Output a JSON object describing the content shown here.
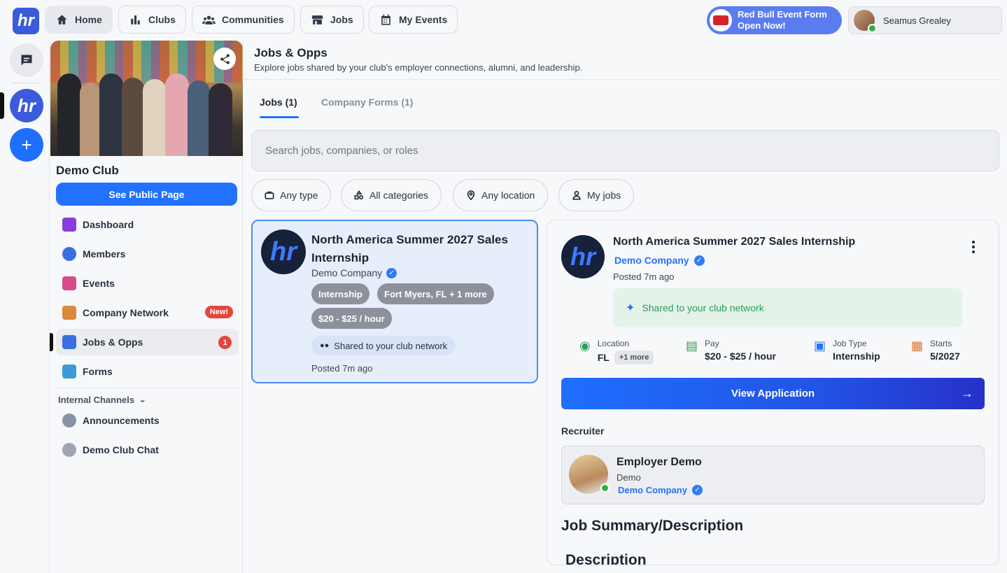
{
  "topnav": {
    "logo_text": "hr",
    "items": [
      {
        "label": "Home",
        "icon": "home-icon",
        "active": true
      },
      {
        "label": "Clubs",
        "icon": "bar-chart-icon",
        "active": false
      },
      {
        "label": "Communities",
        "icon": "people-icon",
        "active": false
      },
      {
        "label": "Jobs",
        "icon": "store-icon",
        "active": false
      },
      {
        "label": "My Events",
        "icon": "calendar-icon",
        "active": false
      }
    ],
    "promo": {
      "line1": "Red Bull Event Form",
      "line2": "Open Now!"
    },
    "user": {
      "name": "Seamus Grealey",
      "status": "online"
    }
  },
  "rail": {
    "club_logo_text": "hr",
    "add_symbol": "+"
  },
  "club": {
    "name": "Demo Club",
    "public_button": "See Public Page",
    "menu": [
      {
        "label": "Dashboard",
        "icon": "dashboard-icon",
        "color": "#8b3bd9"
      },
      {
        "label": "Members",
        "icon": "members-icon",
        "color": "#3b6fe0"
      },
      {
        "label": "Events",
        "icon": "events-calendar-icon",
        "color": "#d94a8c"
      },
      {
        "label": "Company Network",
        "icon": "network-icon",
        "color": "#d98a3b",
        "badge": "New!"
      },
      {
        "label": "Jobs & Opps",
        "icon": "jobs-icon",
        "color": "#3b6fe0",
        "count": "1",
        "active": true
      },
      {
        "label": "Forms",
        "icon": "forms-icon",
        "color": "#3b9bd9"
      }
    ],
    "channels_heading": "Internal Channels",
    "channels": [
      {
        "label": "Announcements",
        "icon": "megaphone-icon"
      },
      {
        "label": "Demo Club Chat",
        "icon": "chat-bubble-icon"
      }
    ]
  },
  "main": {
    "title": "Jobs & Opps",
    "subtitle": "Explore jobs shared by your club's employer connections, alumni, and leadership.",
    "tabs": [
      {
        "label": "Jobs (1)",
        "active": true
      },
      {
        "label": "Company Forms (1)",
        "active": false
      }
    ],
    "search_placeholder": "Search jobs, companies, or roles",
    "filters": [
      {
        "label": "Any type",
        "icon": "briefcase-icon"
      },
      {
        "label": "All categories",
        "icon": "shapes-icon"
      },
      {
        "label": "Any location",
        "icon": "location-pin-icon"
      },
      {
        "label": "My jobs",
        "icon": "user-icon"
      }
    ]
  },
  "job_card": {
    "logo_text": "hr",
    "title": "North America Summer 2027 Sales Internship",
    "company": "Demo Company",
    "chips": [
      "Internship",
      "Fort Myers, FL + 1 more",
      "$20 - $25 / hour"
    ],
    "shared": "Shared to your club network",
    "posted": "Posted 7m ago"
  },
  "detail": {
    "logo_text": "hr",
    "title": "North America Summer 2027 Sales Internship",
    "company": "Demo Company",
    "posted": "Posted 7m ago",
    "shared": "Shared to your club network",
    "stats": {
      "location_label": "Location",
      "location_value": "FL",
      "location_more": "+1 more",
      "pay_label": "Pay",
      "pay_value": "$20 - $25 / hour",
      "type_label": "Job Type",
      "type_value": "Internship",
      "start_label": "Starts",
      "start_value": "5/2027"
    },
    "view_button": "View Application",
    "recruiter_label": "Recruiter",
    "recruiter": {
      "name": "Employer Demo",
      "title": "Demo",
      "company": "Demo Company"
    },
    "summary_heading": "Job Summary/Description",
    "description_heading": "Description"
  },
  "colors": {
    "accent": "#2272ff",
    "badge": "#e5453d",
    "shared_green": "#2f9b57"
  }
}
